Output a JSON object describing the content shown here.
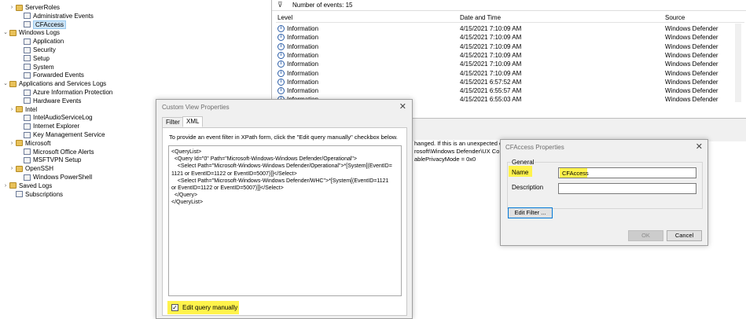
{
  "tree": {
    "items": [
      {
        "label": "ServerRoles",
        "icon": "folder-icon",
        "chev": "›"
      },
      {
        "label": "Administrative Events",
        "icon": "filter-icon",
        "chev": ""
      },
      {
        "label": "CFAccess",
        "icon": "filter-icon",
        "chev": "",
        "selected": true
      },
      {
        "label": "Windows Logs",
        "icon": "folder-icon",
        "chev": "⌄"
      },
      {
        "label": "Application",
        "icon": "log-icon",
        "chev": ""
      },
      {
        "label": "Security",
        "icon": "log-icon",
        "chev": ""
      },
      {
        "label": "Setup",
        "icon": "log-icon",
        "chev": ""
      },
      {
        "label": "System",
        "icon": "log-icon",
        "chev": ""
      },
      {
        "label": "Forwarded Events",
        "icon": "log-icon",
        "chev": ""
      },
      {
        "label": "Applications and Services Logs",
        "icon": "folder-icon",
        "chev": "⌄"
      },
      {
        "label": "Azure Information Protection",
        "icon": "log-icon",
        "chev": ""
      },
      {
        "label": "Hardware Events",
        "icon": "log-icon",
        "chev": ""
      },
      {
        "label": "Intel",
        "icon": "folder-icon",
        "chev": "›"
      },
      {
        "label": "IntelAudioServiceLog",
        "icon": "log-icon",
        "chev": ""
      },
      {
        "label": "Internet Explorer",
        "icon": "log-icon",
        "chev": ""
      },
      {
        "label": "Key Management Service",
        "icon": "log-icon",
        "chev": ""
      },
      {
        "label": "Microsoft",
        "icon": "folder-icon",
        "chev": "›"
      },
      {
        "label": "Microsoft Office Alerts",
        "icon": "log-icon",
        "chev": ""
      },
      {
        "label": "MSFTVPN Setup",
        "icon": "log-icon",
        "chev": ""
      },
      {
        "label": "OpenSSH",
        "icon": "folder-icon",
        "chev": "›"
      },
      {
        "label": "Windows PowerShell",
        "icon": "log-icon",
        "chev": ""
      },
      {
        "label": "Saved Logs",
        "icon": "folder-icon",
        "chev": "›"
      },
      {
        "label": "Subscriptions",
        "icon": "log-icon",
        "chev": ""
      }
    ]
  },
  "list": {
    "event_count": "Number of events: 15",
    "columns": {
      "level": "Level",
      "datetime": "Date and Time",
      "source": "Source"
    },
    "rows": [
      {
        "level": "Information",
        "datetime": "4/15/2021 7:10:09 AM",
        "source": "Windows Defender"
      },
      {
        "level": "Information",
        "datetime": "4/15/2021 7:10:09 AM",
        "source": "Windows Defender"
      },
      {
        "level": "Information",
        "datetime": "4/15/2021 7:10:09 AM",
        "source": "Windows Defender"
      },
      {
        "level": "Information",
        "datetime": "4/15/2021 7:10:09 AM",
        "source": "Windows Defender"
      },
      {
        "level": "Information",
        "datetime": "4/15/2021 7:10:09 AM",
        "source": "Windows Defender"
      },
      {
        "level": "Information",
        "datetime": "4/15/2021 7:10:09 AM",
        "source": "Windows Defender"
      },
      {
        "level": "Information",
        "datetime": "4/15/2021 6:57:52 AM",
        "source": "Windows Defender"
      },
      {
        "level": "Information",
        "datetime": "4/15/2021 6:55:57 AM",
        "source": "Windows Defender"
      },
      {
        "level": "Information",
        "datetime": "4/15/2021 6:55:03 AM",
        "source": "Windows Defender"
      }
    ],
    "detail_lines": [
      "hanged. If this is an unexpected eve",
      "rosoft\\Windows Defender\\UX Co",
      "ablePrivacyMode = 0x0"
    ]
  },
  "custom_view": {
    "title": "Custom View Properties",
    "tabs": {
      "filter": "Filter",
      "xml": "XML"
    },
    "hint": "To provide an event filter in XPath form, click the \"Edit query manually\" checkbox below.",
    "xml_lines": [
      "<QueryList>",
      "  <Query Id=\"0\" Path=\"Microsoft-Windows-Windows Defender/Operational\">",
      "    <Select Path=\"Microsoft-Windows-Windows Defender/Operational\">*[System[(EventID=",
      "1121 or EventID=1122 or EventID=5007)]]</Select>",
      "    <Select Path=\"Microsoft-Windows-Windows Defender/WHC\">*[System[(EventID=1121",
      "or EventID=1122 or EventID=5007)]]</Select>",
      "  </Query>",
      "</QueryList>"
    ],
    "edit_manually_label": "Edit query manually",
    "edit_manually_checked": "✓"
  },
  "cf_props": {
    "title": "CFAccess Properties",
    "group_label": "General",
    "name_label": "Name",
    "name_value": "CFAccess",
    "description_label": "Description",
    "description_value": "",
    "edit_filter_label": "Edit Filter ...",
    "ok_label": "OK",
    "cancel_label": "Cancel"
  },
  "colors": {
    "highlight": "#fff34c",
    "selection": "#cce4f7",
    "info_blue": "#2c5ea8"
  }
}
